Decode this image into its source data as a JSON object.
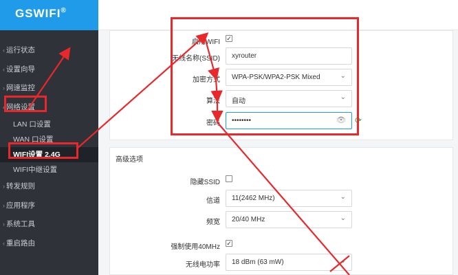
{
  "brand": {
    "name": "GSWIFI",
    "reg": "®"
  },
  "sidebar": {
    "items": [
      {
        "label": "运行状态",
        "chevron": "‹"
      },
      {
        "label": "设置向导",
        "chevron": "‹"
      },
      {
        "label": "网速监控",
        "chevron": "›"
      },
      {
        "label": "网络设置",
        "chevron": "‹"
      },
      {
        "label": "LAN 口设置"
      },
      {
        "label": "WAN 口设置"
      },
      {
        "label": "WIFI设置 2.4G"
      },
      {
        "label": "WIFI中继设置"
      },
      {
        "label": "转发规则",
        "chevron": "›"
      },
      {
        "label": "应用程序",
        "chevron": "›"
      },
      {
        "label": "系统工具",
        "chevron": "›"
      },
      {
        "label": "重启路由",
        "chevron": "‹"
      }
    ]
  },
  "basic": {
    "enable_label": "启用WIFI",
    "enable_checked": "✓",
    "ssid_label": "无线名称(SSID)",
    "ssid_value": "xyrouter",
    "enc_label": "加密方式",
    "enc_value": "WPA-PSK/WPA2-PSK Mixed",
    "algo_label": "算法",
    "algo_value": "自动",
    "pwd_label": "密码",
    "pwd_value": "••••••••",
    "eye_icon": "👁",
    "refresh_icon": "⟳",
    "caret": "⌄"
  },
  "advanced": {
    "title": "高级选项",
    "hide_label": "隐藏SSID",
    "hide_checked": "",
    "channel_label": "信道",
    "channel_value": "11(2462 MHz)",
    "bw_label": "频宽",
    "bw_value": "20/40 MHz",
    "force40_label": "强制使用40MHz",
    "force40_checked": "✓",
    "power_label": "无线电功率",
    "power_value": "18 dBm (63 mW)"
  },
  "colors": {
    "accent": "#1f9be9",
    "annotation": "#e8282b",
    "sidebar_bg": "#2f3238"
  }
}
